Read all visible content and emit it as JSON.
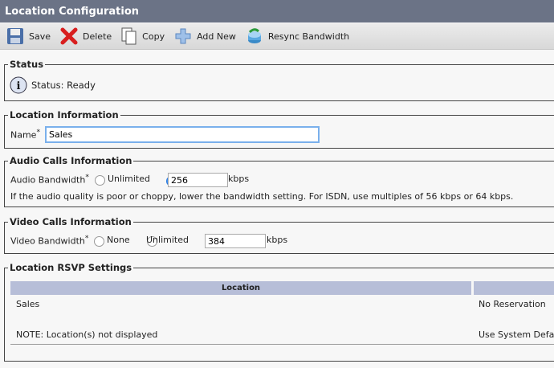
{
  "title": "Location Configuration",
  "toolbar": {
    "save": "Save",
    "delete": "Delete",
    "copy": "Copy",
    "add_new": "Add New",
    "resync": "Resync Bandwidth"
  },
  "status": {
    "legend": "Status",
    "text": "Status: Ready"
  },
  "location_info": {
    "legend": "Location Information",
    "name_label": "Name",
    "required": "*",
    "name_value": "Sales"
  },
  "audio": {
    "legend": "Audio Calls Information",
    "label": "Audio Bandwidth",
    "required": "*",
    "unlimited": "Unlimited",
    "value": "256",
    "unit": "kbps",
    "selected": "custom",
    "note": "If the audio quality is poor or choppy, lower the bandwidth setting. For ISDN, use multiples of 56 kbps or 64 kbps."
  },
  "video": {
    "legend": "Video Calls Information",
    "label": "Video Bandwidth",
    "required": "*",
    "none": "None",
    "unlimited": "Unlimited",
    "value": "384",
    "unit": "kbps",
    "selected": "custom"
  },
  "rsvp": {
    "legend": "Location RSVP Settings",
    "columns": [
      "Location",
      ""
    ],
    "rows": [
      [
        "Sales",
        "No Reservation"
      ],
      [
        "NOTE: Location(s) not displayed",
        "Use System Defau"
      ]
    ]
  }
}
